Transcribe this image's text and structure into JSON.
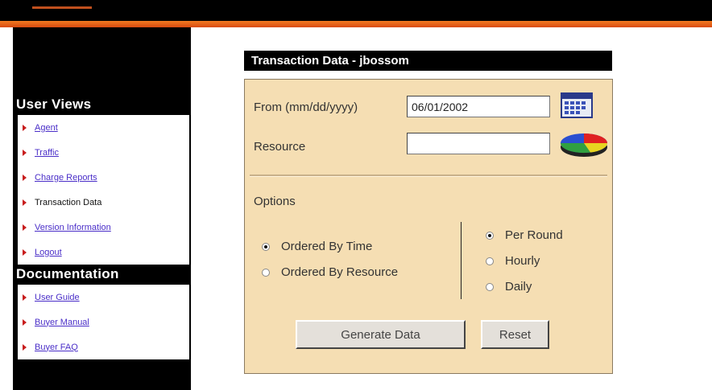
{
  "sidebar": {
    "user_views_title": "User Views",
    "user_views": [
      {
        "label": "Agent",
        "link": true
      },
      {
        "label": "Traffic",
        "link": true
      },
      {
        "label": "Charge Reports",
        "link": true
      },
      {
        "label": "Transaction Data",
        "link": false
      },
      {
        "label": "Version Information",
        "link": true
      },
      {
        "label": "Logout",
        "link": true
      }
    ],
    "documentation_title": "Documentation",
    "documentation": [
      {
        "label": "User Guide",
        "link": true
      },
      {
        "label": "Buyer Manual",
        "link": true
      },
      {
        "label": "Buyer FAQ",
        "link": true
      }
    ]
  },
  "panel": {
    "title": "Transaction Data - jbossom",
    "from_label": "From (mm/dd/yyyy)",
    "from_value": "06/01/2002",
    "resource_label": "Resource",
    "resource_value": "",
    "options_label": "Options",
    "order_options": [
      "Ordered By Time",
      "Ordered By Resource"
    ],
    "order_selected": 0,
    "interval_options": [
      "Per Round",
      "Hourly",
      "Daily"
    ],
    "interval_selected": 0,
    "generate_label": "Generate Data",
    "reset_label": "Reset"
  },
  "icons": {
    "calendar": "calendar-icon",
    "pie": "pie-chart-icon",
    "bullet": "red-triangle-bullet-icon"
  },
  "colors": {
    "panel_bg": "#f5deb3",
    "accent": "#e8641a",
    "bullet": "#c81e1e",
    "link": "#4a2ec8"
  }
}
